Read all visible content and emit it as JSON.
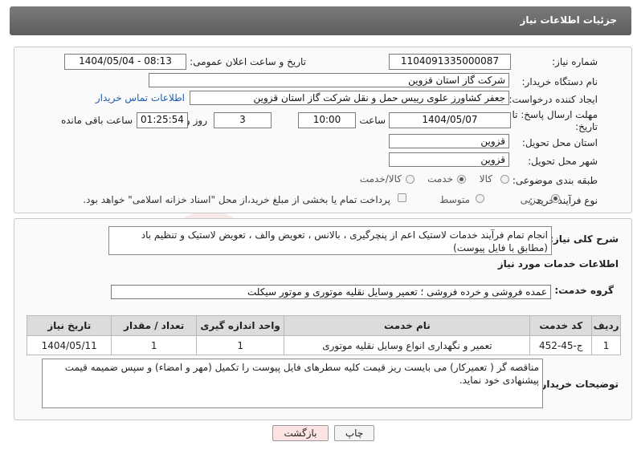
{
  "header": {
    "title": "جزئیات اطلاعات نیاز"
  },
  "form": {
    "need_number_label": "شماره نیاز:",
    "need_number": "1104091335000087",
    "announce_label": "تاریخ و ساعت اعلان عمومی:",
    "announce_value": "1404/05/04 - 08:13",
    "buyer_org_label": "نام دستگاه خریدار:",
    "buyer_org": "شرکت گاز استان قزوین",
    "creator_label": "ایجاد کننده درخواست:",
    "creator": "جعفر کشاورز علوی رییس حمل و نقل شرکت گاز استان قزوین",
    "contact_link": "اطلاعات تماس خریدار",
    "deadline_label": "مهلت ارسال پاسخ: تا تاریخ:",
    "deadline_date": "1404/05/07",
    "hour_label": "ساعت",
    "deadline_hour": "10:00",
    "days_value": "3",
    "days_label": "روز و",
    "remaining_value": "01:25:54",
    "remaining_label": "ساعت باقی مانده",
    "province_label": "استان محل تحویل:",
    "province": "قزوین",
    "city_label": "شهر محل تحویل:",
    "city": "قزوین",
    "category_label": "طبقه بندی موضوعی:",
    "category_options": [
      "کالا",
      "خدمت",
      "کالا/خدمت"
    ],
    "category_selected": "خدمت",
    "process_label": "نوع فرآیند خرید :",
    "process_options": [
      "جزیی",
      "متوسط"
    ],
    "process_selected": "جزیی",
    "payment_note": "پرداخت تمام یا بخشی از مبلغ خرید،از محل \"اسناد خزانه اسلامی\" خواهد بود."
  },
  "summary": {
    "label": "شرح کلی نیاز:",
    "text": "انجام تمام فرآیند خدمات لاستیک اعم از پنچرگیری ، بالانس ، تعویض والف ، تعویض لاستیک و تنظیم باد (مطابق با فایل پیوست)"
  },
  "services": {
    "title": "اطلاعات خدمات مورد نیاز",
    "group_label": "گروه خدمت:",
    "group_value": "عمده فروشی و خرده فروشی ؛ تعمیر وسایل نقلیه موتوری و موتور سیکلت",
    "columns": [
      "ردیف",
      "کد خدمت",
      "نام خدمت",
      "واحد اندازه گیری",
      "تعداد / مقدار",
      "تاریخ نیاز"
    ],
    "rows": [
      [
        "1",
        "ج-45-452",
        "تعمیر و نگهداری انواع وسایل نقلیه موتوری",
        "1",
        "1",
        "1404/05/11"
      ]
    ]
  },
  "notes": {
    "label": "توضیحات خریدار:",
    "text": "مناقصه گر ( تعمیرکار) می بایست ریز قیمت کلیه سطرهای فایل پیوست را تکمیل (مهر و امضاء) و سپس ضمیمه قیمت پیشنهادی خود نماید."
  },
  "buttons": {
    "print": "چاپ",
    "back": "بازگشت"
  },
  "colors": {
    "header": "#6b6b6b",
    "link": "#1f5db0",
    "back_button": "#fde4e4",
    "print_button": "#f4f4f4"
  }
}
